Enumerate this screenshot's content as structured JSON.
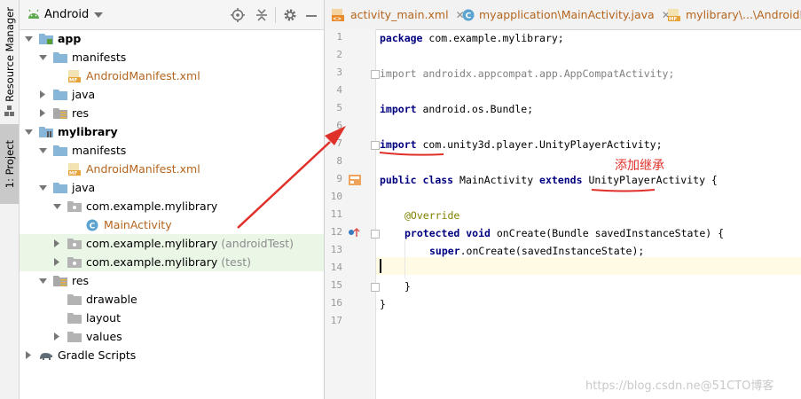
{
  "sidebar_tabs": {
    "resource_manager": "Resource Manager",
    "project": "1: Project"
  },
  "project_panel": {
    "title": "Android"
  },
  "tree": [
    {
      "label": "app",
      "bold": true
    },
    {
      "label": "manifests"
    },
    {
      "label": "AndroidManifest.xml",
      "badge": "MF"
    },
    {
      "label": "java"
    },
    {
      "label": "res"
    },
    {
      "label": "mylibrary",
      "bold": true
    },
    {
      "label": "manifests"
    },
    {
      "label": "AndroidManifest.xml",
      "badge": "MF"
    },
    {
      "label": "java"
    },
    {
      "label": "com.example.mylibrary"
    },
    {
      "label": "MainActivity",
      "badge": "C"
    },
    {
      "label": "com.example.mylibrary",
      "suffix": "(androidTest)"
    },
    {
      "label": "com.example.mylibrary",
      "suffix": "(test)"
    },
    {
      "label": "res"
    },
    {
      "label": "drawable"
    },
    {
      "label": "layout"
    },
    {
      "label": "values"
    },
    {
      "label": "Gradle Scripts"
    }
  ],
  "editor_tabs": [
    {
      "label": "activity_main.xml",
      "badge": "<>"
    },
    {
      "label": "myapplication\\MainActivity.java",
      "badge": "C"
    },
    {
      "label": "mylibrary\\...\\AndroidM",
      "badge": "MF"
    }
  ],
  "line_numbers": [
    "1",
    "2",
    "3",
    "4",
    "5",
    "6",
    "7",
    "8",
    "9",
    "10",
    "11",
    "12",
    "13",
    "14",
    "15",
    "16",
    "17"
  ],
  "code": {
    "l1_kw": "package",
    "l1_rest": " com.example.mylibrary;",
    "l3_kw": "import",
    "l3_rest": " androidx.appcompat.app.AppCompatActivity;",
    "l5_kw": "import",
    "l5_rest": " android.os.Bundle;",
    "l7_kw": "import",
    "l7_rest": " com.unity3d.player.UnityPlayerActivity;",
    "l9_kw1": "public",
    "l9_kw2": "class",
    "l9_name": " MainActivity ",
    "l9_kw3": "extends",
    "l9_rest": " UnityPlayerActivity {",
    "l11": "@Override",
    "l12_kw1": "protected",
    "l12_kw2": "void",
    "l12_rest": " onCreate(Bundle savedInstanceState) {",
    "l13_kw": "super",
    "l13_rest": ".onCreate(savedInstanceState);",
    "l15": "}",
    "l16": "}"
  },
  "annotation_note": "添加继承",
  "watermark": "https://blog.csdn.ne@51CTO博客",
  "colors": {
    "annotation_red": "#e0302a",
    "keyword": "#000080",
    "selected_tab": "#c9c9c9"
  }
}
